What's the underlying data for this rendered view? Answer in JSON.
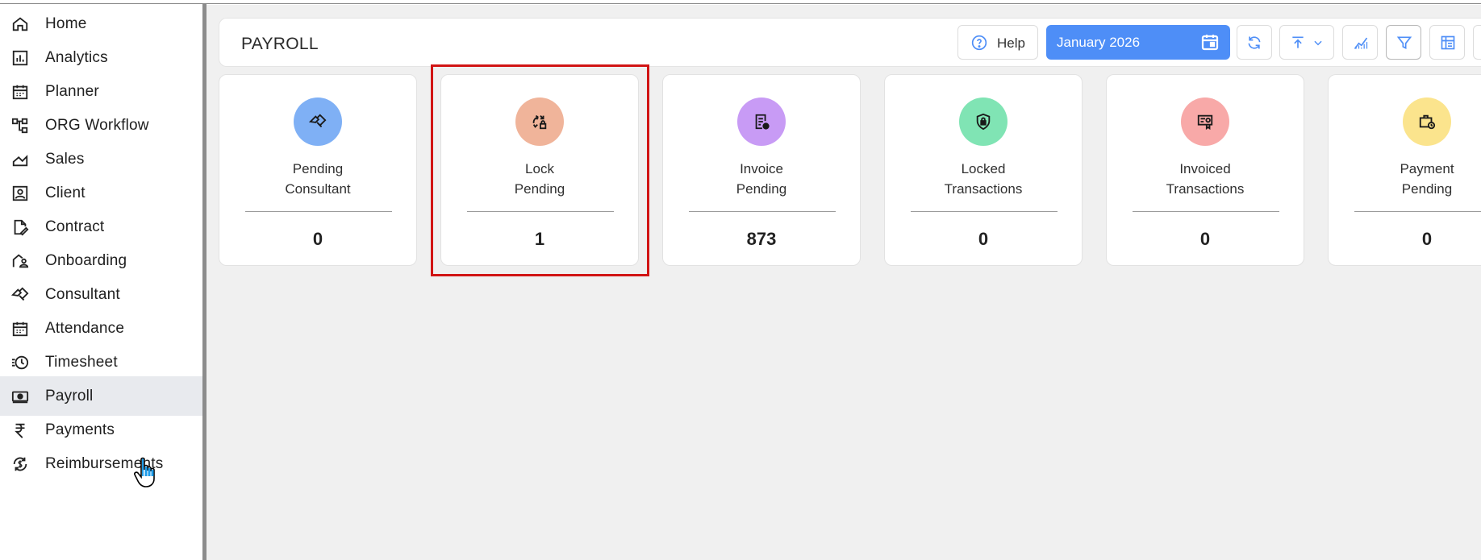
{
  "sidebar": {
    "items": [
      {
        "label": "Home",
        "icon": "home-icon"
      },
      {
        "label": "Analytics",
        "icon": "analytics-icon"
      },
      {
        "label": "Planner",
        "icon": "calendar-icon"
      },
      {
        "label": "ORG Workflow",
        "icon": "workflow-icon"
      },
      {
        "label": "Sales",
        "icon": "sales-chart-icon"
      },
      {
        "label": "Client",
        "icon": "client-icon"
      },
      {
        "label": "Contract",
        "icon": "contract-icon"
      },
      {
        "label": "Onboarding",
        "icon": "onboarding-icon"
      },
      {
        "label": "Consultant",
        "icon": "handshake-icon"
      },
      {
        "label": "Attendance",
        "icon": "calendar-icon"
      },
      {
        "label": "Timesheet",
        "icon": "clock-icon"
      },
      {
        "label": "Payroll",
        "icon": "payroll-icon",
        "active": true
      },
      {
        "label": "Payments",
        "icon": "rupee-icon"
      },
      {
        "label": "Reimbursements",
        "icon": "reimbursement-icon"
      }
    ]
  },
  "header": {
    "title": "PAYROLL",
    "help_label": "Help",
    "date_label": "January 2026"
  },
  "cards": [
    {
      "line1": "Pending",
      "line2": "Consultant",
      "value": "0",
      "color": "#7fb0f5",
      "icon": "handshake-icon"
    },
    {
      "line1": "Lock",
      "line2": "Pending",
      "value": "1",
      "color": "#f0b49a",
      "icon": "lock-refresh-icon"
    },
    {
      "line1": "Invoice",
      "line2": "Pending",
      "value": "873",
      "color": "#c89bf5",
      "icon": "invoice-icon"
    },
    {
      "line1": "Locked",
      "line2": "Transactions",
      "value": "0",
      "color": "#80e4b4",
      "icon": "shield-lock-icon"
    },
    {
      "line1": "Invoiced",
      "line2": "Transactions",
      "value": "0",
      "color": "#f8a9a8",
      "icon": "invoice-money-icon"
    },
    {
      "line1": "Payment",
      "line2": "Pending",
      "value": "0",
      "color": "#fbe48d",
      "icon": "briefcase-clock-icon"
    }
  ],
  "colors": {
    "accent": "#4e8ef7",
    "highlight": "#d11414"
  }
}
